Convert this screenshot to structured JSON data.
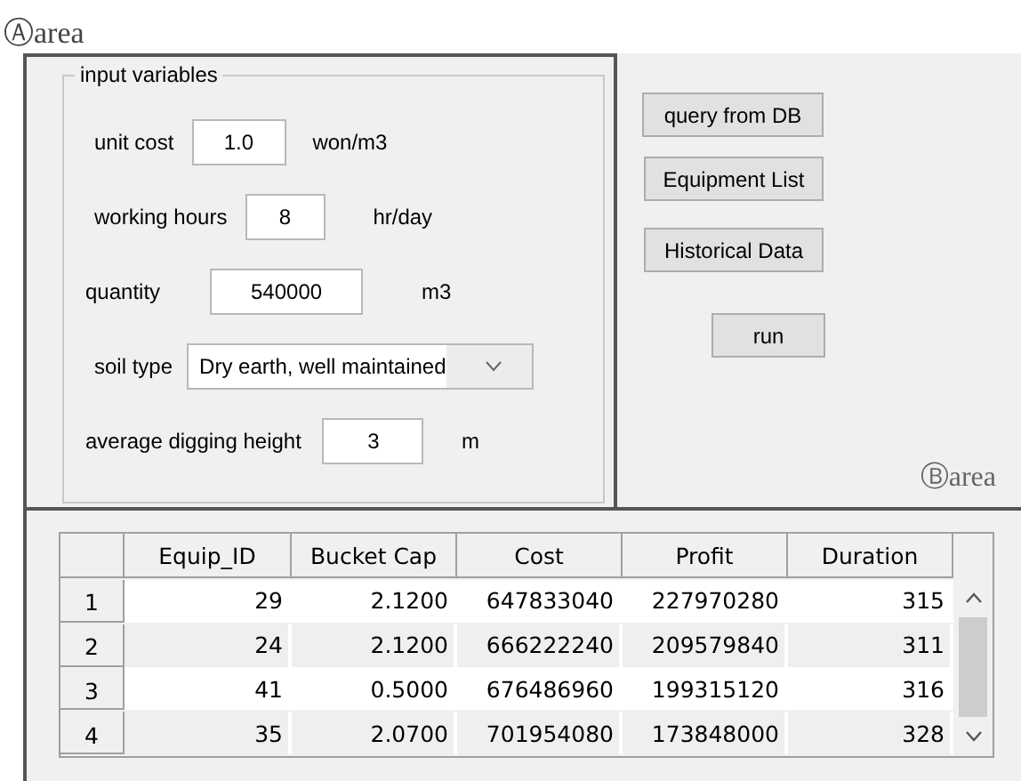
{
  "area_a_label": "Ⓐarea",
  "input_group": {
    "title": "input variables",
    "fields": [
      {
        "kind": "text",
        "label": "unit cost",
        "value": "1.0",
        "unit": "won/m3"
      },
      {
        "kind": "text",
        "label": "working hours",
        "value": "8",
        "unit": "hr/day"
      },
      {
        "kind": "text",
        "label": "quantity",
        "value": "540000",
        "unit": "m3"
      },
      {
        "kind": "select",
        "label": "soil type",
        "value": "Dry earth, well maintained"
      },
      {
        "kind": "text",
        "label": "average digging height",
        "value": "3",
        "unit": "m"
      }
    ]
  },
  "buttons": [
    "query from DB",
    "Equipment List",
    "Historical Data",
    "run"
  ],
  "area_b_label": "Ⓑarea",
  "table": {
    "columns": [
      "Equip_ID",
      "Bucket Cap",
      "Cost",
      "Profit",
      "Duration"
    ],
    "rows": [
      {
        "index": "1",
        "cells": [
          "29",
          "2.1200",
          "647833040",
          "227970280",
          "315"
        ]
      },
      {
        "index": "2",
        "cells": [
          "24",
          "2.1200",
          "666222240",
          "209579840",
          "311"
        ]
      },
      {
        "index": "3",
        "cells": [
          "41",
          "0.5000",
          "676486960",
          "199315120",
          "316"
        ]
      },
      {
        "index": "4",
        "cells": [
          "35",
          "2.0700",
          "701954080",
          "173848000",
          "328"
        ]
      }
    ]
  }
}
